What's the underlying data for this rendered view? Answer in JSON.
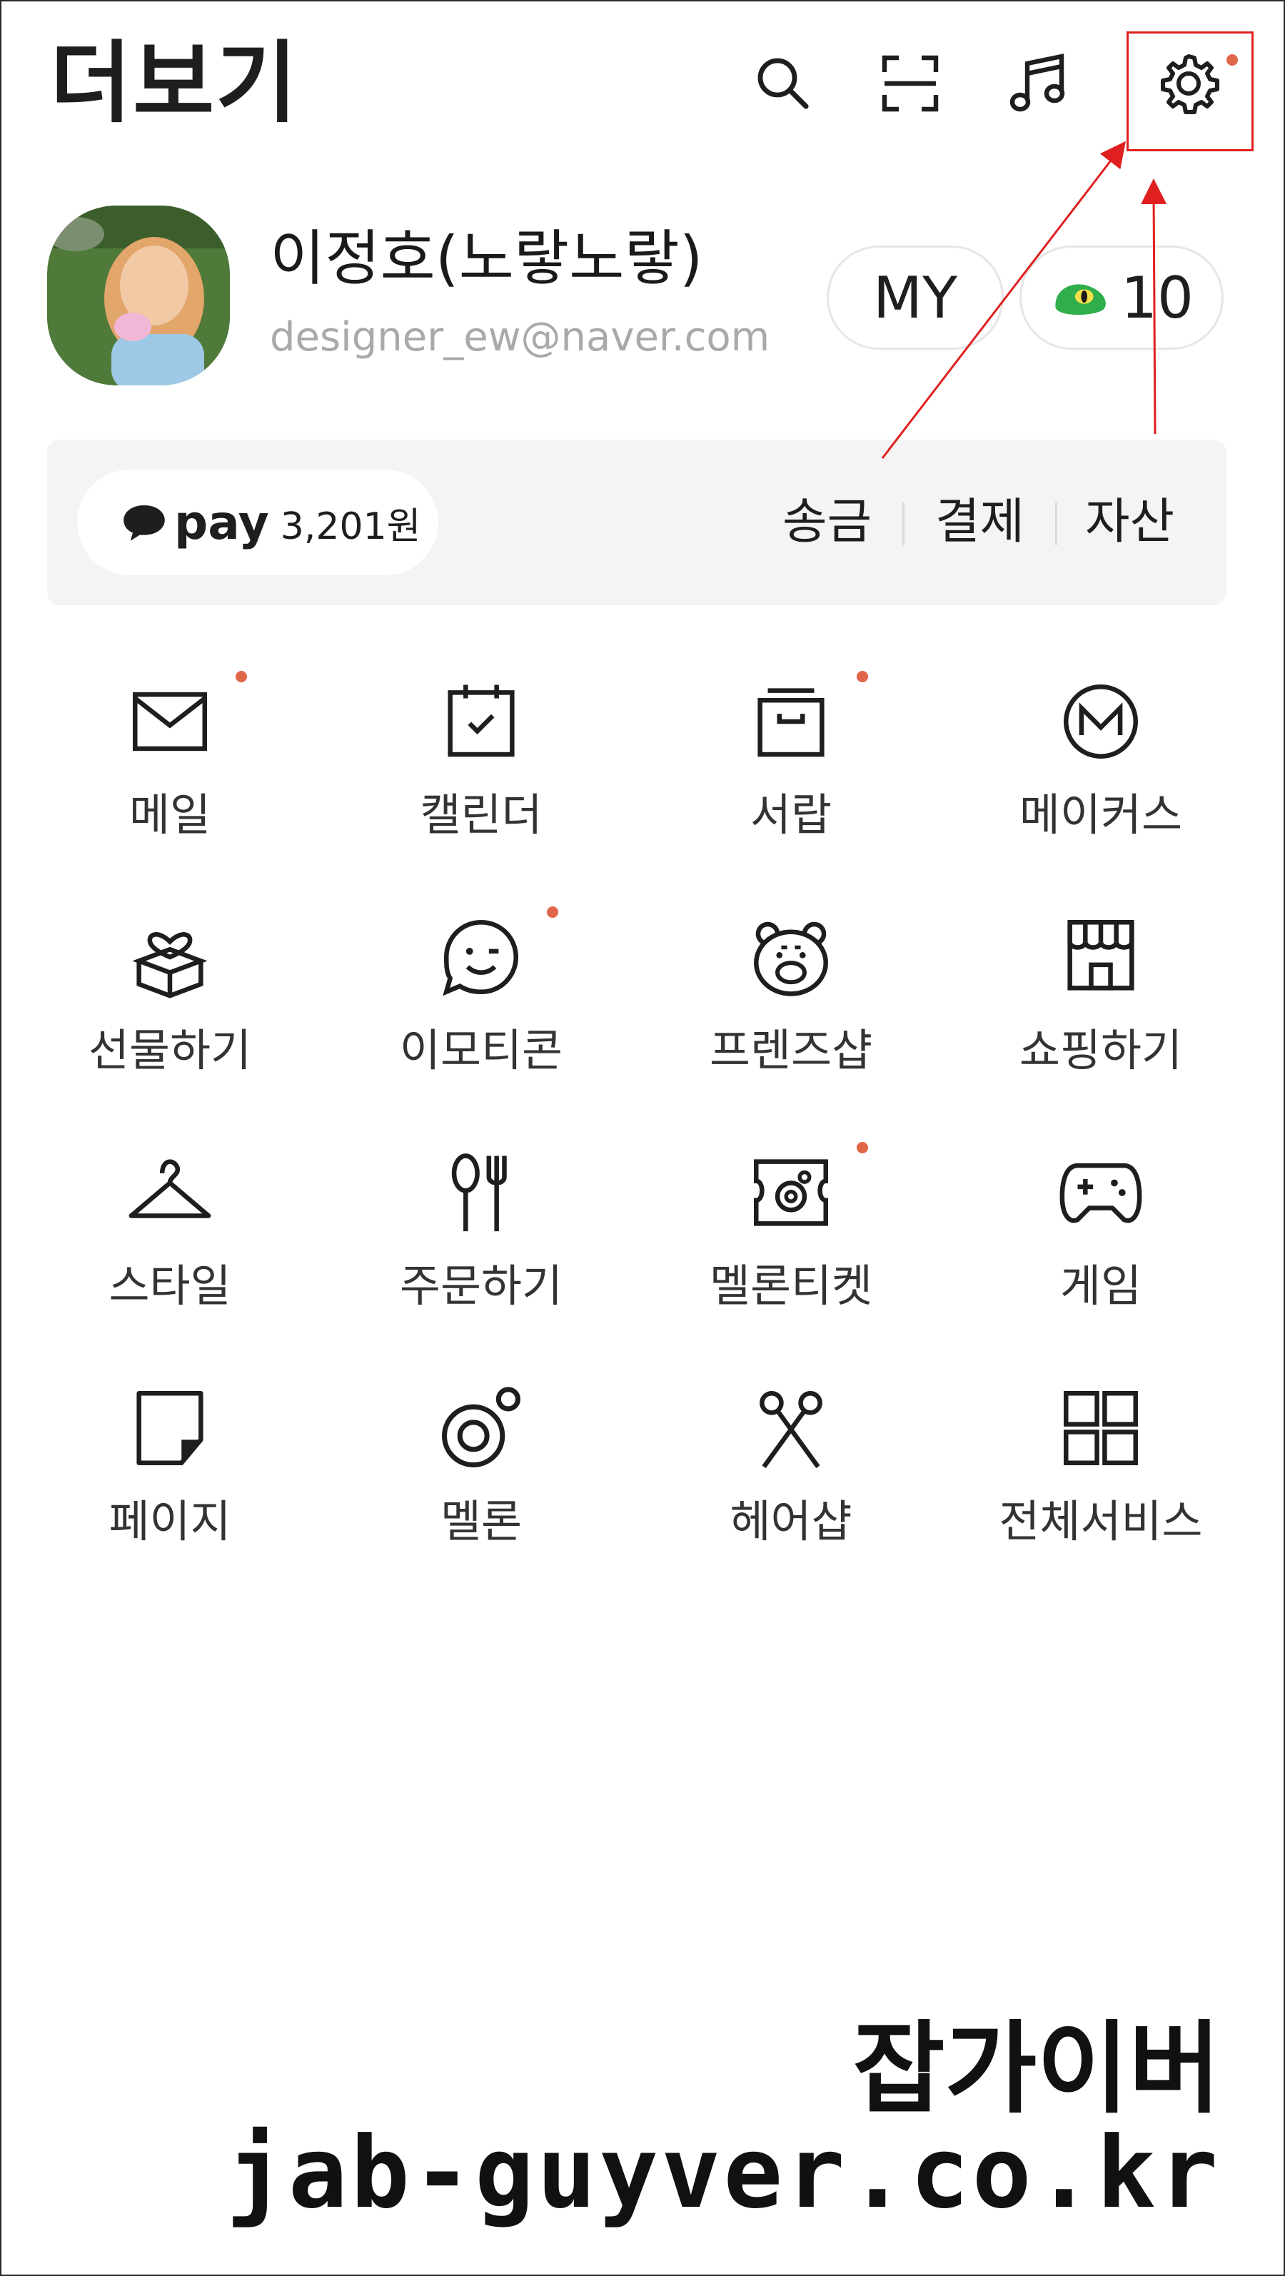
{
  "header": {
    "title": "더보기",
    "icons": [
      "search-icon",
      "scan-icon",
      "music-icon",
      "settings-icon"
    ]
  },
  "profile": {
    "name": "이정호(노랗노랗)",
    "email": "designer_ew@naver.com",
    "my_label": "MY",
    "points": "10"
  },
  "pay": {
    "logo_text": "pay",
    "balance": "3,201원",
    "actions": [
      "송금",
      "결제",
      "자산"
    ]
  },
  "services": [
    {
      "label": "메일",
      "icon": "mail-icon",
      "badge": true
    },
    {
      "label": "캘린더",
      "icon": "calendar-icon",
      "badge": false
    },
    {
      "label": "서랍",
      "icon": "drawer-icon",
      "badge": true
    },
    {
      "label": "메이커스",
      "icon": "makers-icon",
      "badge": false
    },
    {
      "label": "선물하기",
      "icon": "gift-icon",
      "badge": false
    },
    {
      "label": "이모티콘",
      "icon": "emoticon-icon",
      "badge": true
    },
    {
      "label": "프렌즈샵",
      "icon": "friends-shop-icon",
      "badge": false
    },
    {
      "label": "쇼핑하기",
      "icon": "shopping-icon",
      "badge": false
    },
    {
      "label": "스타일",
      "icon": "hanger-icon",
      "badge": false
    },
    {
      "label": "주문하기",
      "icon": "utensils-icon",
      "badge": false
    },
    {
      "label": "멜론티켓",
      "icon": "ticket-icon",
      "badge": true
    },
    {
      "label": "게임",
      "icon": "gamepad-icon",
      "badge": false
    },
    {
      "label": "페이지",
      "icon": "page-icon",
      "badge": false
    },
    {
      "label": "멜론",
      "icon": "melon-icon",
      "badge": false
    },
    {
      "label": "헤어샵",
      "icon": "scissors-icon",
      "badge": false
    },
    {
      "label": "전체서비스",
      "icon": "grid-icon",
      "badge": false
    }
  ],
  "colors": {
    "badge": "#e0664a",
    "annotation": "#e02020",
    "pay_bar": "#f4f4f4",
    "email": "#a9a9a9"
  },
  "watermark": {
    "line1": "잡가이버",
    "line2": "jab-guyver.co.kr"
  }
}
